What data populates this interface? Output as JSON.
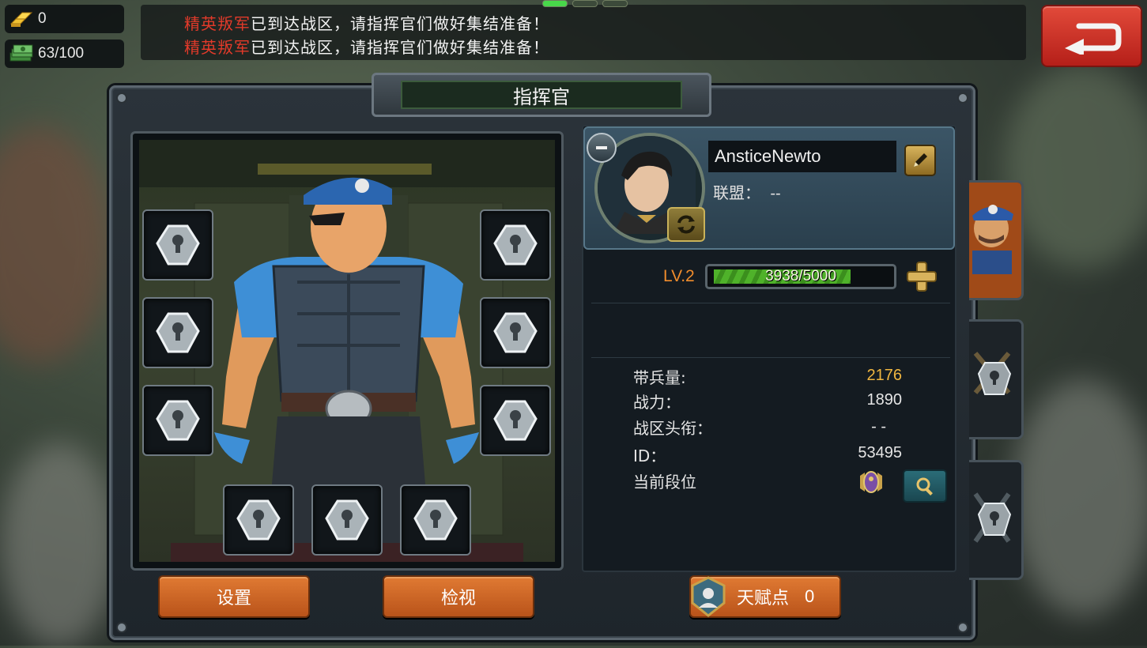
{
  "resources": {
    "gold": {
      "icon": "gold-bars-icon",
      "value": "0"
    },
    "cash": {
      "icon": "cash-stack-icon",
      "value": "63/100"
    }
  },
  "broadcast": {
    "messages": [
      {
        "highlight": "精英叛军",
        "text": "已到达战区，请指挥官们做好集结准备！"
      },
      {
        "highlight": "精英叛军",
        "text": "已到达战区，请指挥官们做好集结准备！"
      }
    ]
  },
  "panel": {
    "title": "指挥官"
  },
  "profile": {
    "name": "AnsticeNewto",
    "alliance_label": "联盟：",
    "alliance_value": "--",
    "level": "LV.2",
    "xp_text": "3938/5000",
    "xp_fraction": 0.7876
  },
  "stats": [
    {
      "label": "带兵量:",
      "value": "2176",
      "highlight": true
    },
    {
      "label": "战力：",
      "value": "1890",
      "highlight": false
    },
    {
      "label": "战区头衔：",
      "value": "- -",
      "highlight": false
    },
    {
      "label": "ID：",
      "value": "53495",
      "highlight": false
    },
    {
      "label": "当前段位",
      "value": "",
      "highlight": false
    }
  ],
  "buttons": {
    "settings": "设置",
    "inspect": "检视",
    "talent": "天赋点",
    "talent_points": "0"
  },
  "colors": {
    "accent_orange": "#f08c2c",
    "gold_value": "#f0b640",
    "highlight_red": "#e23a2a",
    "xp_green": "#4fb22a",
    "back_red": "#d23a2c"
  }
}
